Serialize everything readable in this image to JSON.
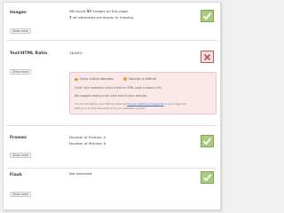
{
  "images": {
    "title": "Images",
    "found_prefix": "We found",
    "found_count": "37",
    "found_suffix": "images on this page.",
    "alt_count": "7",
    "alt_suffix": "alt attributes are empty or missing.",
    "button": "Show more",
    "status": "pass",
    "status_color": "#a9cc7f"
  },
  "ratio": {
    "title": "Text/HTML Ratio",
    "value": "16.89%",
    "button": "Show more",
    "status": "fail",
    "status_color": "#c25454",
    "legend": [
      {
        "label": "Solve critical attention",
        "icon": "warning-dot"
      },
      {
        "label": "Solution is difficult",
        "icon": "difficulty-dot"
      }
    ],
    "line1": "Ouch! Your website's ratio of text to HTML code is below 15%.",
    "line2": "We suggest adding a bit more text to your website.",
    "line3_prefix": "You can strengthen your SEO by checking",
    "line3_link": "the eye catching of keywords",
    "line3_suffix": "on your page and",
    "line4": "adding more text that pertains to your website's content."
  },
  "frames": {
    "title": "Frames",
    "line1": "Number of Frames: 0",
    "line2": "Number of iframes: 0",
    "button": "Show more",
    "status": "pass"
  },
  "flash": {
    "title": "Flash",
    "value": "Not detected",
    "button": "Show more",
    "status": "pass"
  }
}
